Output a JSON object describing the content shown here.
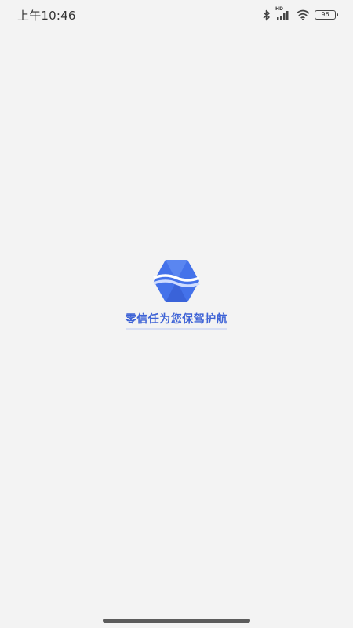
{
  "status_bar": {
    "time": "上午10:46",
    "network_label": "HD",
    "battery_level": "96"
  },
  "splash": {
    "slogan": "零信任为您保驾护航",
    "brand_color": "#4472ea"
  }
}
